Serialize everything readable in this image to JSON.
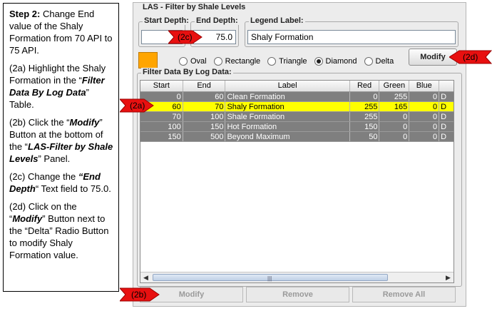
{
  "instructions": {
    "step_label": "Step 2:",
    "step_text": " Change End value of the Shaly Formation from  70 API to 75 API.",
    "p2a_1": "(2a) Highlight the Shaly Formation in the “",
    "p2a_bold": "Filter Data By Log Data",
    "p2a_2": "” Table.",
    "p2b_1": "(2b) Click the “",
    "p2b_bold1": "Modify",
    "p2b_2": "” Button at the bottom of the “",
    "p2b_bold2": "LAS-Filter by Shale Levels",
    "p2b_3": "” Panel.",
    "p2c_1": "(2c) Change the ",
    "p2c_bold": "“End Depth",
    "p2c_2": "“ Text field to 75.0.",
    "p2d_1": "(2d) Click on the “",
    "p2d_bold": "Modify",
    "p2d_2": "” Button next to the “Delta” Radio Button to modify Shaly Formation value."
  },
  "panel": {
    "title": "LAS - Filter by Shale Levels",
    "start_depth_label": "Start Depth:",
    "start_depth_value": "",
    "end_depth_label": "End Depth:",
    "end_depth_value": "75.0",
    "legend_label_label": "Legend Label:",
    "legend_label_value": "Shaly Formation",
    "swatch_color": "#FFA500",
    "shapes": [
      "Oval",
      "Rectangle",
      "Triangle",
      "Diamond",
      "Delta"
    ],
    "selected_shape": "Diamond",
    "modify_label": "Modify",
    "table_group_label": "Filter Data By Log Data:"
  },
  "table": {
    "headers": [
      "Start",
      "End",
      "Label",
      "Red",
      "Green",
      "Blue",
      ""
    ],
    "rows": [
      [
        "0",
        "60",
        "Clean Formation",
        "0",
        "255",
        "0",
        "D"
      ],
      [
        "60",
        "70",
        "Shaly Formation",
        "255",
        "165",
        "0",
        "D"
      ],
      [
        "70",
        "100",
        "Shale Formation",
        "255",
        "0",
        "0",
        "D"
      ],
      [
        "100",
        "150",
        "Hot Formation",
        "150",
        "0",
        "0",
        "D"
      ],
      [
        "150",
        "500",
        "Beyond Maximum",
        "50",
        "0",
        "0",
        "D"
      ]
    ],
    "selected_row": 1
  },
  "bottom_buttons": {
    "modify": "Modify",
    "remove": "Remove",
    "remove_all": "Remove All"
  },
  "callouts": {
    "c2a": "(2a)",
    "c2b": "(2b)",
    "c2c": "(2c)",
    "c2d": "(2d)"
  },
  "colors": {
    "callout_red": "#E81010",
    "row_selected": "#FFFF00",
    "row_default": "#7F7F7F"
  }
}
